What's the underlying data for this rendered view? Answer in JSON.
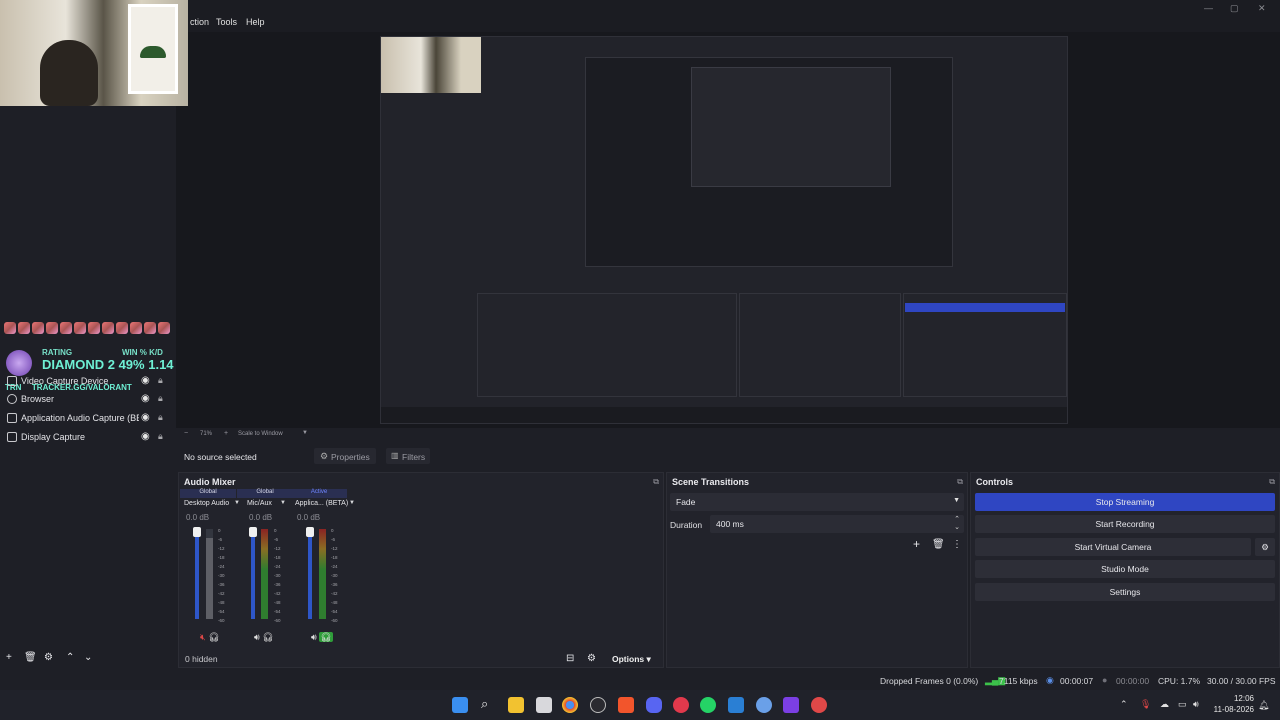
{
  "menu": [
    "ction",
    "Tools",
    "Help"
  ],
  "window_controls": [
    "—",
    "▢",
    "✕"
  ],
  "overlay": {
    "rating_label": "RATING",
    "win_kd_label": "WIN % K/D",
    "rank": "DIAMOND 2",
    "win_pct": "49%",
    "kd": "1.14",
    "trn": "TRN",
    "tracker_url": "TRACKER.GG/VALORANT"
  },
  "sources": [
    {
      "name": "Video Capture Device"
    },
    {
      "name": "Browser"
    },
    {
      "name": "Application Audio Capture (BET"
    },
    {
      "name": "Display Capture"
    }
  ],
  "zoom": {
    "minus": "−",
    "value": "71%",
    "plus": "+",
    "fit": "Scale to Window"
  },
  "selection": {
    "none": "No source selected",
    "properties": "Properties",
    "filters": "Filters"
  },
  "audio_mixer": {
    "title": "Audio Mixer",
    "channels": [
      {
        "tag": "Global",
        "name": "Desktop Audio",
        "db": "0.0 dB"
      },
      {
        "tag": "Global",
        "name": "Mic/Aux",
        "db": "0.0 dB"
      },
      {
        "tag": "Active",
        "name": "Applica... (BETA)",
        "db": "0.0 dB"
      }
    ],
    "scale": [
      "0",
      "-6",
      "-12",
      "-18",
      "-24",
      "-30",
      "-36",
      "-42",
      "-48",
      "-54",
      "-60"
    ],
    "hidden": "0 hidden",
    "options": "Options"
  },
  "transitions": {
    "title": "Scene Transitions",
    "type": "Fade",
    "duration_label": "Duration",
    "duration": "400 ms"
  },
  "controls": {
    "title": "Controls",
    "stop_streaming": "Stop Streaming",
    "start_recording": "Start Recording",
    "start_virtual_camera": "Start Virtual Camera",
    "studio_mode": "Studio Mode",
    "settings": "Settings",
    "accent": "#2f46c2"
  },
  "status": {
    "dropped": "Dropped Frames 0 (0.0%)",
    "bitrate": "7115 kbps",
    "stream_time": "00:00:07",
    "rec_time": "00:00:00",
    "cpu": "CPU: 1.7%",
    "fps": "30.00 / 30.00 FPS"
  },
  "clock": {
    "time": "12:06",
    "date": "11-08-2026"
  }
}
